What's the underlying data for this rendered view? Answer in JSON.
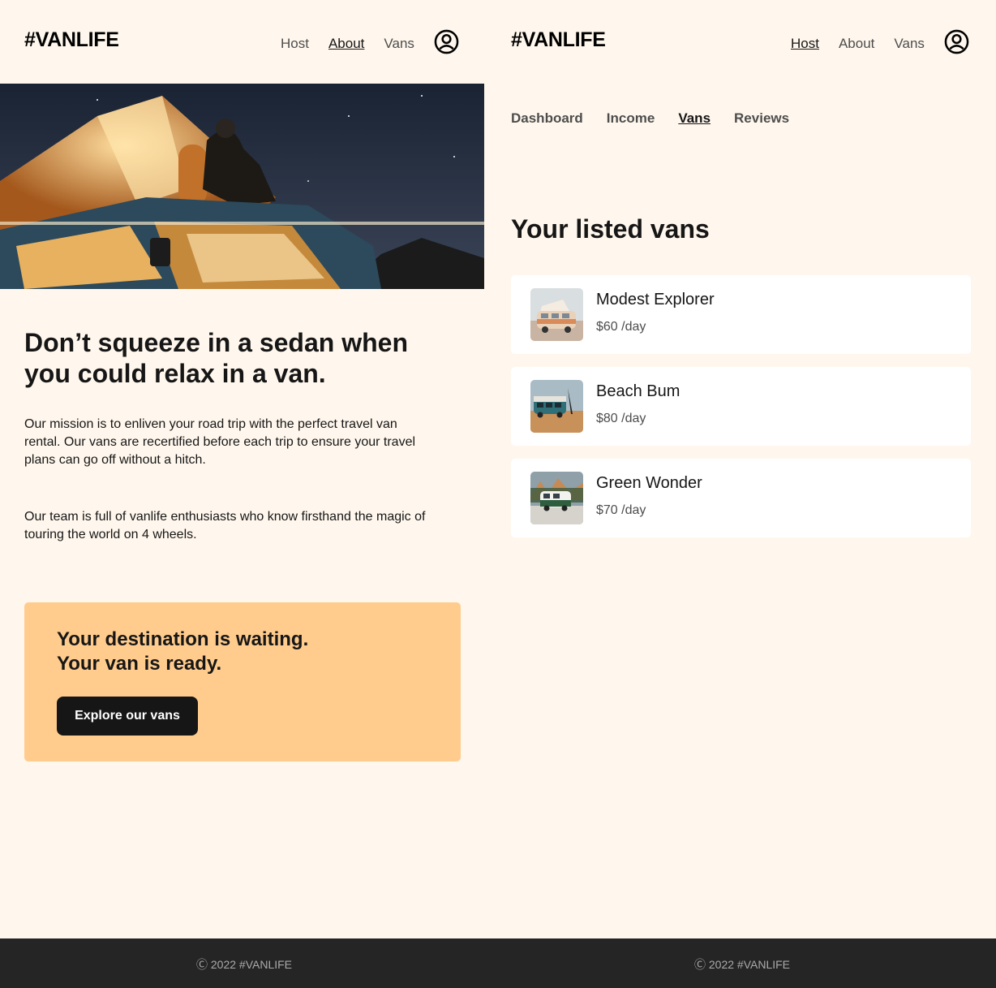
{
  "left": {
    "header": {
      "logo": "#VANLIFE",
      "nav": [
        {
          "label": "Host",
          "active": false
        },
        {
          "label": "About",
          "active": true
        },
        {
          "label": "Vans",
          "active": false
        }
      ]
    },
    "about": {
      "title_line1": "Don’t squeeze in a sedan when",
      "title_line2": "you could relax in a van.",
      "para1_line1": "Our mission is to enliven your road trip with the perfect travel van",
      "para1_line2": "rental. Our vans are recertified before each trip to ensure your travel",
      "para1_line3": "plans can go off without a hitch.",
      "para2_line1": "Our team is full of vanlife enthusiasts who know firsthand the magic of",
      "para2_line2": "touring the world on 4 wheels."
    },
    "cta": {
      "line1": "Your destination is waiting.",
      "line2": "Your van is ready.",
      "button": "Explore our vans"
    },
    "footer": "Ⓒ 2022 #VANLIFE"
  },
  "right": {
    "header": {
      "logo": "#VANLIFE",
      "nav": [
        {
          "label": "Host",
          "active": true
        },
        {
          "label": "About",
          "active": false
        },
        {
          "label": "Vans",
          "active": false
        }
      ]
    },
    "host_nav": [
      {
        "label": "Dashboard",
        "active": false
      },
      {
        "label": "Income",
        "active": false
      },
      {
        "label": "Vans",
        "active": true
      },
      {
        "label": "Reviews",
        "active": false
      }
    ],
    "listed_title": "Your listed vans",
    "vans": [
      {
        "name": "Modest Explorer",
        "price": "$60 /day"
      },
      {
        "name": "Beach Bum",
        "price": "$80 /day"
      },
      {
        "name": "Green Wonder",
        "price": "$70 /day"
      }
    ],
    "footer": "Ⓒ 2022 #VANLIFE"
  },
  "colors": {
    "background": "#FFF7ED",
    "cta_background": "#FFCC8D",
    "button": "#161616",
    "footer": "#252525"
  },
  "icons": {
    "avatar": "user-circle-icon"
  }
}
